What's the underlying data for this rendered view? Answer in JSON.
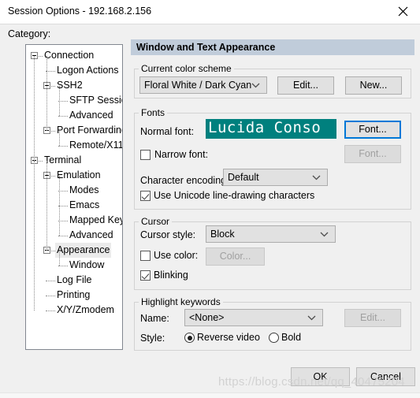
{
  "window": {
    "title": "Session Options - 192.168.2.156",
    "close_icon": "close-icon"
  },
  "sidebar": {
    "label": "Category:",
    "items": [
      {
        "label": "Connection",
        "depth": 0,
        "expander": true,
        "selected": false
      },
      {
        "label": "Logon Actions",
        "depth": 1,
        "expander": false,
        "selected": false
      },
      {
        "label": "SSH2",
        "depth": 1,
        "expander": true,
        "selected": false
      },
      {
        "label": "SFTP Session",
        "depth": 2,
        "expander": false,
        "selected": false
      },
      {
        "label": "Advanced",
        "depth": 2,
        "expander": false,
        "selected": false
      },
      {
        "label": "Port Forwarding",
        "depth": 1,
        "expander": true,
        "selected": false
      },
      {
        "label": "Remote/X11",
        "depth": 2,
        "expander": false,
        "selected": false
      },
      {
        "label": "Terminal",
        "depth": 0,
        "expander": true,
        "selected": false
      },
      {
        "label": "Emulation",
        "depth": 1,
        "expander": true,
        "selected": false
      },
      {
        "label": "Modes",
        "depth": 2,
        "expander": false,
        "selected": false
      },
      {
        "label": "Emacs",
        "depth": 2,
        "expander": false,
        "selected": false
      },
      {
        "label": "Mapped Keys",
        "depth": 2,
        "expander": false,
        "selected": false
      },
      {
        "label": "Advanced",
        "depth": 2,
        "expander": false,
        "selected": false
      },
      {
        "label": "Appearance",
        "depth": 1,
        "expander": true,
        "selected": true
      },
      {
        "label": "Window",
        "depth": 2,
        "expander": false,
        "selected": false
      },
      {
        "label": "Log File",
        "depth": 1,
        "expander": false,
        "selected": false
      },
      {
        "label": "Printing",
        "depth": 1,
        "expander": false,
        "selected": false
      },
      {
        "label": "X/Y/Zmodem",
        "depth": 1,
        "expander": false,
        "selected": false
      }
    ]
  },
  "pane": {
    "header": "Window and Text Appearance",
    "color_scheme": {
      "legend": "Current color scheme",
      "value": "Floral White / Dark Cyan",
      "edit_label": "Edit...",
      "new_label": "New..."
    },
    "fonts": {
      "legend": "Fonts",
      "normal_font_label": "Normal font:",
      "normal_font_sample": "Lucida Conso",
      "normal_font_button": "Font...",
      "narrow_font_label": "Narrow font:",
      "narrow_font_button": "Font...",
      "narrow_font_checked": false,
      "encoding_label": "Character encoding:",
      "encoding_value": "Default",
      "unicode_label": "Use Unicode line-drawing characters",
      "unicode_checked": true
    },
    "cursor": {
      "legend": "Cursor",
      "style_label": "Cursor style:",
      "style_value": "Block",
      "use_color_label": "Use color:",
      "use_color_checked": false,
      "color_button": "Color...",
      "blinking_label": "Blinking",
      "blinking_checked": true
    },
    "highlight": {
      "legend": "Highlight keywords",
      "name_label": "Name:",
      "name_value": "<None>",
      "edit_label": "Edit...",
      "style_label": "Style:",
      "reverse_video_label": "Reverse video",
      "reverse_video_selected": true,
      "bold_label": "Bold",
      "bold_selected": false
    }
  },
  "footer": {
    "ok_label": "OK",
    "cancel_label": "Cancel"
  },
  "watermark": "https://blog.csdn.net/qq_40475204",
  "colors": {
    "header_band": "#c0ccda",
    "font_sample_bg": "#00807e",
    "focus_blue": "#0078d7"
  }
}
